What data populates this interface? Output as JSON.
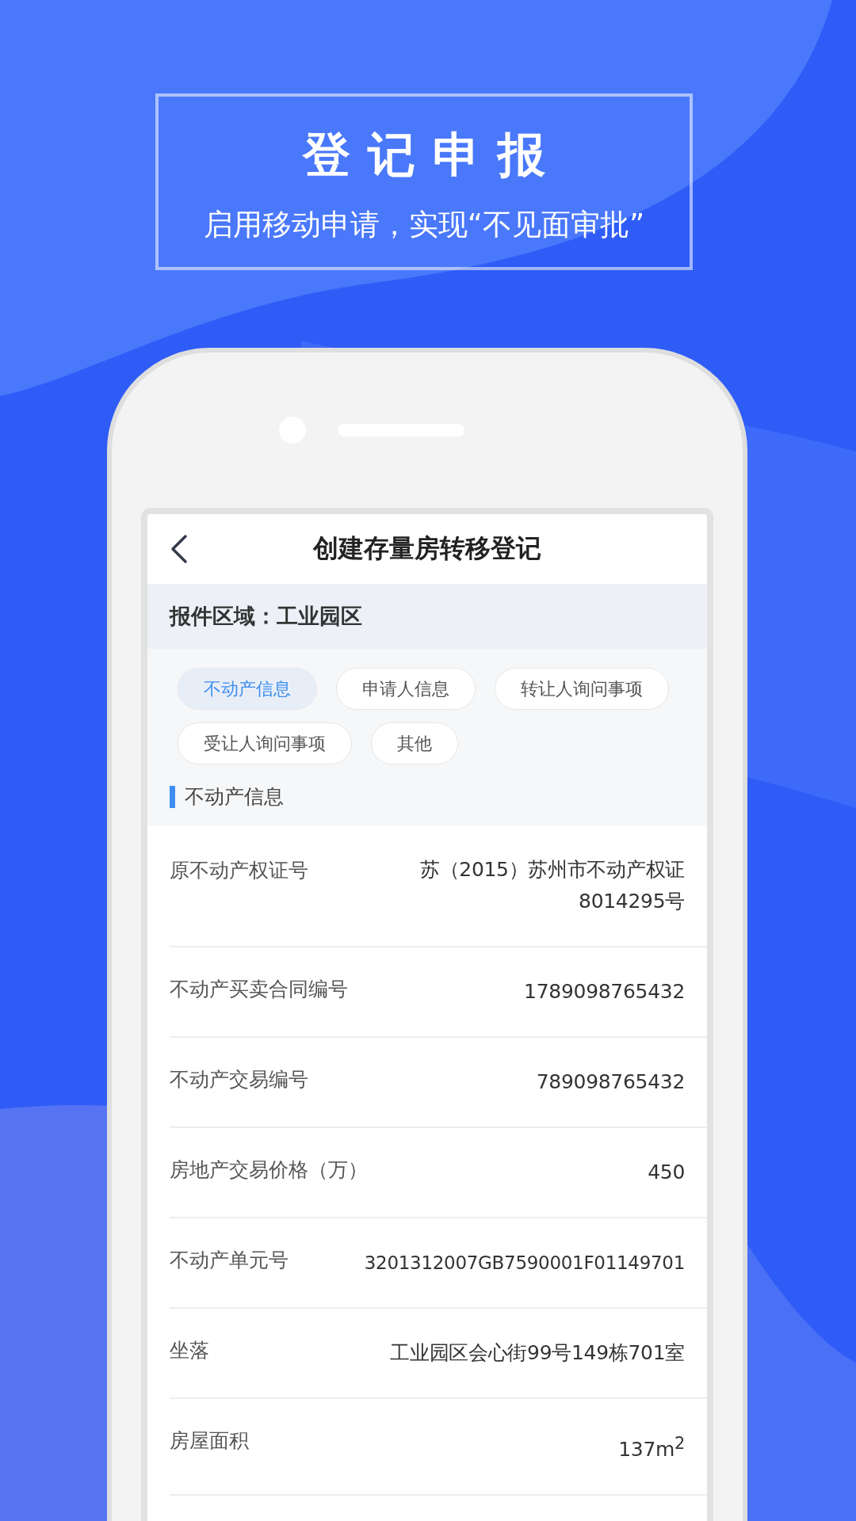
{
  "banner": {
    "title": "登记申报",
    "subtitle": "启用移动申请，实现“不见面审批”"
  },
  "nav": {
    "title": "创建存量房转移登记"
  },
  "region": {
    "text": "报件区域：工业园区"
  },
  "tabs": [
    {
      "label": "不动产信息",
      "selected": true
    },
    {
      "label": "申请人信息",
      "selected": false
    },
    {
      "label": "转让人询问事项",
      "selected": false
    },
    {
      "label": "受让人询问事项",
      "selected": false
    },
    {
      "label": "其他",
      "selected": false
    }
  ],
  "section": {
    "title": "不动产信息"
  },
  "fields": [
    {
      "label": "原不动产权证号",
      "value": "苏（2015）苏州市不动产权证8014295号"
    },
    {
      "label": "不动产买卖合同编号",
      "value": "1789098765432"
    },
    {
      "label": "不动产交易编号",
      "value": "789098765432"
    },
    {
      "label": "房地产交易价格（万）",
      "value": "450"
    },
    {
      "label": "不动产单元号",
      "value": "3201312007GB7590001F01149701"
    },
    {
      "label": "坐落",
      "value": "工业园区会心街99号149栋701室"
    },
    {
      "label": "房屋面积",
      "value": "137m$^{2}$"
    }
  ]
}
